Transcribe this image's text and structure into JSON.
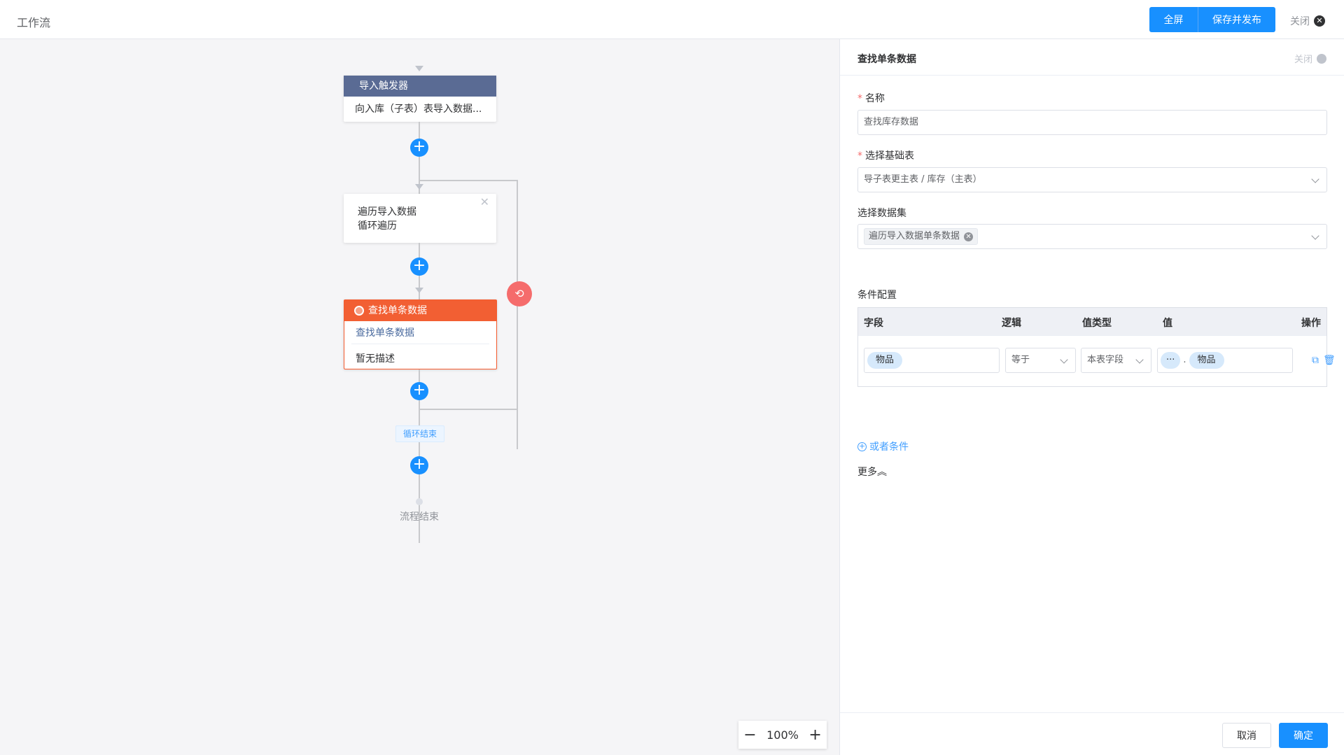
{
  "header": {
    "title": "工作流",
    "fullscreen_label": "全屏",
    "save_publish_label": "保存并发布",
    "close_label": "关闭"
  },
  "canvas": {
    "trigger_node": {
      "title": "导入触发器",
      "body": "向入库（子表）表导入数据..."
    },
    "loop_node": {
      "line1": "遍历导入数据",
      "line2": "循环遍历"
    },
    "find_node": {
      "title": "查找单条数据",
      "subtitle": "查找单条数据",
      "description": "暂无描述"
    },
    "loop_end_label": "循环结束",
    "flow_end_label": "流程结束",
    "zoom_level": "100%"
  },
  "panel": {
    "title": "查找单条数据",
    "close_label": "关闭",
    "name_label": "名称",
    "name_value": "查找库存数据",
    "base_table_label": "选择基础表",
    "base_table_value": "导子表更主表 / 库存（主表）",
    "dataset_label": "选择数据集",
    "dataset_tag": "遍历导入数据单条数据",
    "condition_label": "条件配置",
    "columns": {
      "field": "字段",
      "logic": "逻辑",
      "value_type": "值类型",
      "value": "值",
      "action": "操作"
    },
    "row": {
      "field_pill": "物品",
      "logic": "等于",
      "value_type": "本表字段",
      "value_prefix": "···",
      "value_sep": ".",
      "value_pill": "物品"
    },
    "or_condition_label": "或者条件",
    "more_label": "更多",
    "cancel_label": "取消",
    "ok_label": "确定"
  }
}
